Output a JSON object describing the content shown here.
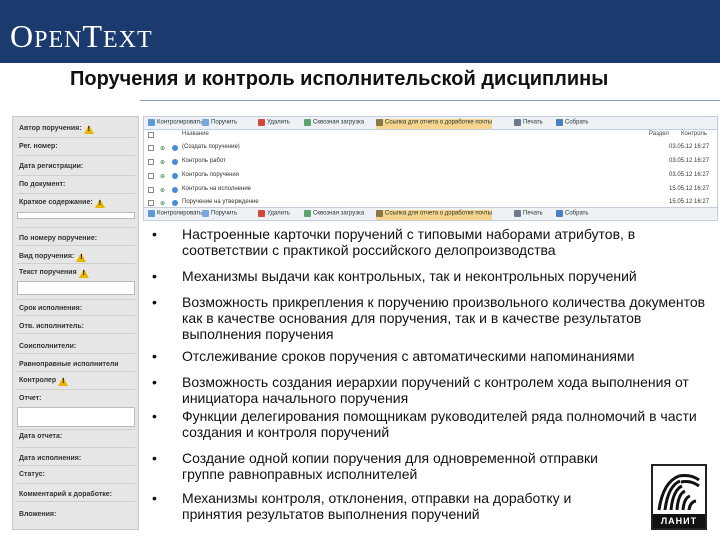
{
  "header": {
    "logo_first": "O",
    "logo_mid": "PEN",
    "logo_t": "T",
    "logo_rest": "EXT",
    "title": "Поручения и контроль исполнительской дисциплины"
  },
  "form": {
    "fields": [
      {
        "label": "Автор поручения:",
        "warn": true
      },
      {
        "label": "Рег. номер:",
        "warn": false
      },
      {
        "label": "Дата регистрации:",
        "warn": false
      },
      {
        "label": "По документ:",
        "warn": false
      },
      {
        "label": "Краткое содержание:",
        "warn": true
      },
      {
        "label": "По номеру поручение:",
        "warn": false
      },
      {
        "label": "Вид поручения:",
        "warn": true
      },
      {
        "label": "Текст поручения",
        "warn": true
      },
      {
        "label": "Срок исполнения:",
        "warn": false
      },
      {
        "label": "Отв. исполнитель:",
        "warn": false
      },
      {
        "label": "Соисполнители:",
        "warn": false
      },
      {
        "label": "Равноправные исполнители",
        "warn": false
      },
      {
        "label": "Контролер",
        "warn": true
      },
      {
        "label": "Отчет:",
        "warn": false
      },
      {
        "label": "Дата отчета:",
        "warn": false
      },
      {
        "label": "Дата исполнения:",
        "warn": false
      },
      {
        "label": "Статус:",
        "warn": false
      },
      {
        "label": "Комментарий к доработке:",
        "warn": false
      },
      {
        "label": "Вложения:",
        "warn": false
      }
    ]
  },
  "toolbar": {
    "items": [
      "Контролировать",
      "Поручить",
      "Удалить",
      "Сквозная загрузка",
      "Ссылка для отчета о доработке почты",
      "Печать",
      "Собрать"
    ]
  },
  "grid": {
    "headers": {
      "name": "Название",
      "date1": "Раздел",
      "date2": "Контроль"
    },
    "rows": [
      {
        "name": "(Создать поручение)",
        "date": "03.05.12 16:27"
      },
      {
        "name": "Контроль работ",
        "date": "03.05.12 16:27"
      },
      {
        "name": "Контроль поручения",
        "date": "03.05.12 16:27"
      },
      {
        "name": "Контроль на исполнение",
        "date": "15.05.12 16:27"
      },
      {
        "name": "Поручение на утверждение",
        "date": "15.05.12 16:27"
      }
    ]
  },
  "bullets": [
    "Настроенные карточки поручений с типовыми наборами атрибутов, в соответствии с практикой российского делопроизводства",
    "Механизмы выдачи как контрольных, так и неконтрольных поручений",
    "Возможность прикрепления к поручению произвольного количества документов как в качестве основания для поручения, так и в качестве результатов выполнения поручения",
    "Отслеживание сроков поручения с автоматическими напоминаниями",
    "Возможность создания иерархии поручений с контролем хода выполнения от инициатора начального поручения",
    "Функции делегирования помощникам руководителей ряда полномочий в части создания и контроля поручений",
    "Создание одной копии поручения для одновременной отправки группе равноправных исполнителей",
    "Механизмы контроля, отклонения, отправки на доработку и принятия результатов выполнения поручений"
  ],
  "bullet_symbol": "•",
  "lanit": {
    "word": "ЛАНИТ"
  },
  "colors": {
    "header_bg": "#1b3a6e",
    "toolbar_bg": "#eef2f7",
    "highlight": "#f7d58f",
    "warn": "#e8b400"
  }
}
